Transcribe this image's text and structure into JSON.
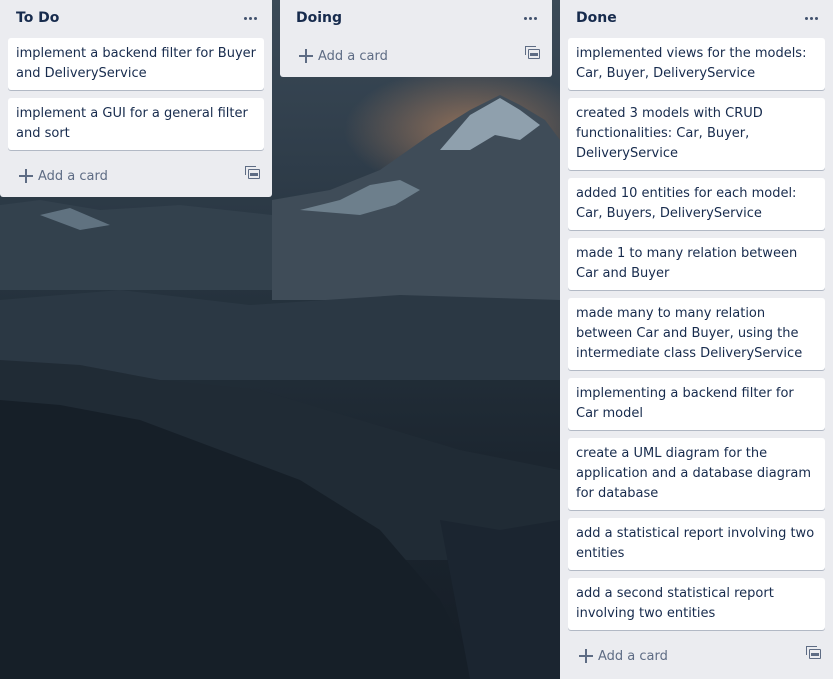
{
  "lists": {
    "todo": {
      "title": "To Do",
      "cards": [
        "implement a backend filter for Buyer and DeliveryService",
        "implement a GUI for a general filter and sort"
      ],
      "add_card_label": "Add a card"
    },
    "doing": {
      "title": "Doing",
      "cards": [],
      "add_card_label": "Add a card"
    },
    "done": {
      "title": "Done",
      "cards": [
        "implemented views for the models: Car, Buyer, DeliveryService",
        "created 3 models with CRUD functionalities: Car, Buyer, DeliveryService",
        "added 10 entities for each model: Car, Buyers, DeliveryService",
        "made 1 to many relation between Car and Buyer",
        "made many to many relation between Car and Buyer, using the intermediate class DeliveryService",
        "implementing a backend filter for Car model",
        "create a UML diagram for the application and a database diagram for database",
        "add a statistical report involving two entities",
        "add a second statistical report involving two entities"
      ],
      "add_card_label": "Add a card"
    }
  },
  "icons": {
    "list_menu": "more-icon",
    "add": "plus-icon",
    "template": "card-template-icon"
  },
  "colors": {
    "list_background": "#ebecf0",
    "card_background": "#ffffff",
    "text": "#172b4d",
    "muted": "#5e6c84"
  }
}
